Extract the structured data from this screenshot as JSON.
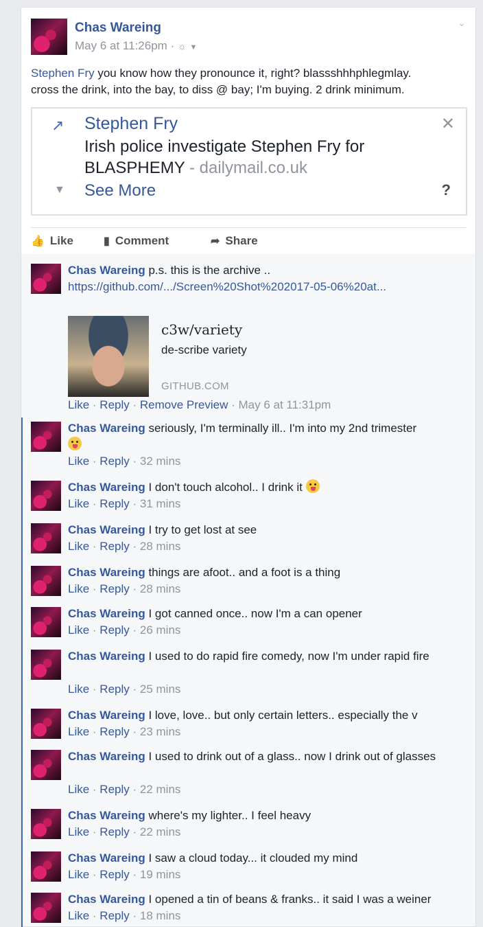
{
  "post": {
    "author": "Chas Wareing",
    "date": "May 6 at 11:26pm",
    "meta_separator": "·",
    "audience_icon": "globe-icon",
    "mention": "Stephen Fry",
    "text_line1_rest": " you know how they pronounce it, right? blassshhhphlegmlay.",
    "text_line2": "cross the drink, into the bay, to diss @ bay; I'm buying. 2 drink minimum.",
    "card": {
      "title": "Stephen Fry",
      "body": "Irish police investigate Stephen Fry for BLASPHEMY",
      "domain_sep": " - ",
      "domain": "dailymail.co.uk",
      "see_more": "See More",
      "question": "?"
    },
    "actions": {
      "like": "Like",
      "comment": "Comment",
      "share": "Share"
    }
  },
  "first_comment": {
    "name": "Chas Wareing",
    "text": " p.s. this is the archive ..",
    "link": "https://github.com/.../Screen%20Shot%202017-05-06%20at...",
    "preview": {
      "title": "c3w/variety",
      "description": "de-scribe variety",
      "domain": "GITHUB.COM"
    },
    "like": "Like",
    "reply": "Reply",
    "remove_preview": "Remove Preview",
    "time": "May 6 at 11:31pm"
  },
  "comments": [
    {
      "name": "Chas Wareing",
      "text": " seriously, I'm terminally ill.. I'm into my 2nd trimester",
      "time": "32 mins"
    },
    {
      "name": "Chas Wareing",
      "text": " I don't touch alcohol.. I drink it ",
      "time": "31 mins"
    },
    {
      "name": "Chas Wareing",
      "text": " I try to get lost at see",
      "time": "28 mins"
    },
    {
      "name": "Chas Wareing",
      "text": " things are afoot.. and a foot is a thing",
      "time": "28 mins"
    },
    {
      "name": "Chas Wareing",
      "text": " I got canned once.. now I'm a can opener",
      "time": "26 mins"
    },
    {
      "name": "Chas Wareing",
      "text": " I used to do rapid fire comedy, now I'm under rapid fire",
      "time": "25 mins"
    },
    {
      "name": "Chas Wareing",
      "text": " I love, love.. but only certain letters.. especially the v",
      "time": "23 mins"
    },
    {
      "name": "Chas Wareing",
      "text": " I used to drink out of a glass.. now I drink out of glasses",
      "time": "22 mins"
    },
    {
      "name": "Chas Wareing",
      "text": " where's my lighter.. I feel heavy",
      "time": "22 mins"
    },
    {
      "name": "Chas Wareing",
      "text": " I saw a cloud today... it clouded my mind",
      "time": "19 mins"
    },
    {
      "name": "Chas Wareing",
      "text": " I opened a tin of beans & franks.. it said I was a weiner",
      "time": "18 mins"
    }
  ],
  "comment_actions": {
    "like": "Like",
    "reply": "Reply",
    "sep": " · "
  }
}
